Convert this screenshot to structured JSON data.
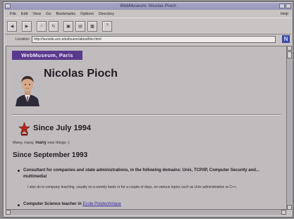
{
  "window": {
    "title": "WebMuseum: Nicolas Pioch"
  },
  "menu": {
    "items": [
      "File",
      "Edit",
      "View",
      "Go",
      "Bookmarks",
      "Options",
      "Directory"
    ],
    "help": "Help"
  },
  "location": {
    "label": "Location:",
    "url": "http://sunsite.unc.edu/louvre/about/bio.html"
  },
  "page": {
    "banner": "WebMuseum, Paris",
    "name": "Nicolas Pioch",
    "since1_heading": "Since July 1994",
    "news_prefix": "Many, many,",
    "news_bold": "many",
    "news_suffix": "new things :)",
    "since2_heading": "Since September 1993",
    "item1_title": "Consultant for companies and state administrations, in the following domains: Unix, TCP/IP, Computer Security and... multimedia!",
    "item1_text": "I also do in-company teaching, usually on a weekly basis or for a couple of days, on various topics such as Unix administration or C++.",
    "item2_title": "Computer Science teacher in",
    "item2_link": "Ecole Polytechnique"
  }
}
